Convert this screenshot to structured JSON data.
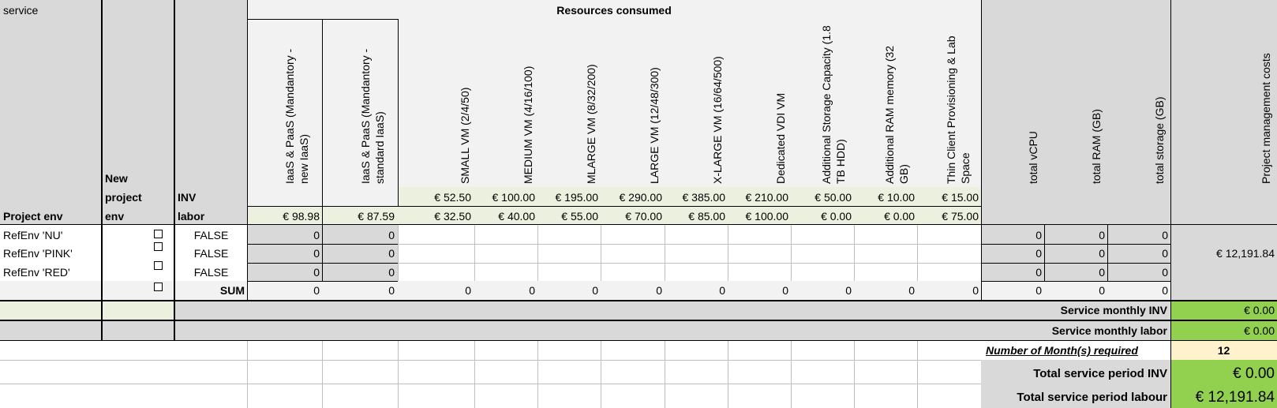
{
  "headers": {
    "service": "service",
    "project_env": "Project env",
    "new_project_env_1": "New",
    "new_project_env_2": "project",
    "new_project_env_3": "env",
    "inv": "INV",
    "labor": "labor",
    "resources_consumed": "Resources consumed"
  },
  "columns": [
    "IaaS & PaaS (Mandantory - new IaaS)",
    "IaaS & PaaS (Mandantory - standard IaaS)",
    "SMALL VM (2/4/50)",
    "MEDIUM VM (4/16/100)",
    "MLARGE VM (8/32/200)",
    "LARGE VM (12/48/300)",
    "X-LARGE VM (16/64/500)",
    "Dedicated VDI VM",
    "Additional Storage Capacity (1.8 TB HDD)",
    "Additional RAM memory (32 GB)",
    "Thin Client Provisioning & Lab Space",
    "total vCPU",
    "total RAM (GB)",
    "total storage (GB)",
    "Project management costs"
  ],
  "inv_prices": [
    "€ 52.50",
    "€ 100.00",
    "€ 195.00",
    "€ 290.00",
    "€ 385.00",
    "€ 210.00",
    "€ 50.00",
    "€ 10.00",
    "€ 15.00"
  ],
  "labor_prices": [
    "€ 98.98",
    "€ 87.59",
    "€ 32.50",
    "€ 40.00",
    "€ 55.00",
    "€ 70.00",
    "€ 85.00",
    "€ 100.00",
    "€ 0.00",
    "€ 0.00",
    "€ 75.00"
  ],
  "rows": [
    {
      "name": "RefEnv 'NU'",
      "flag": "FALSE",
      "iaas_new": "0",
      "iaas_standard": "0",
      "total_vcpu": "0",
      "total_ram": "0",
      "total_storage": "0"
    },
    {
      "name": "RefEnv 'PINK'",
      "flag": "FALSE",
      "iaas_new": "0",
      "iaas_standard": "0",
      "total_vcpu": "0",
      "total_ram": "0",
      "total_storage": "0"
    },
    {
      "name": "RefEnv 'RED'",
      "flag": "FALSE",
      "iaas_new": "0",
      "iaas_standard": "0",
      "total_vcpu": "0",
      "total_ram": "0",
      "total_storage": "0"
    }
  ],
  "project_management_costs": "€ 12,191.84",
  "sum": {
    "label": "SUM",
    "values": [
      "0",
      "0",
      "0",
      "0",
      "0",
      "0",
      "0",
      "0",
      "0",
      "0",
      "0",
      "0",
      "0",
      "0"
    ]
  },
  "summary": {
    "monthly_inv_label": "Service monthly INV",
    "monthly_inv_value": "€ 0.00",
    "monthly_labor_label": "Service monthly labor",
    "monthly_labor_value": "€ 0.00",
    "months_label": "Number of Month(s) required",
    "months_value": "12",
    "total_inv_label": "Total service period INV",
    "total_inv_value": "€ 0.00",
    "total_labour_label": "Total service period labour",
    "total_labour_value": "€ 12,191.84"
  },
  "colors": {
    "header_gray": "#d9d9d9",
    "light_gray": "#f2f2f2",
    "light_green": "#ebf1de",
    "green": "#92d050",
    "cream": "#fff2cc"
  }
}
